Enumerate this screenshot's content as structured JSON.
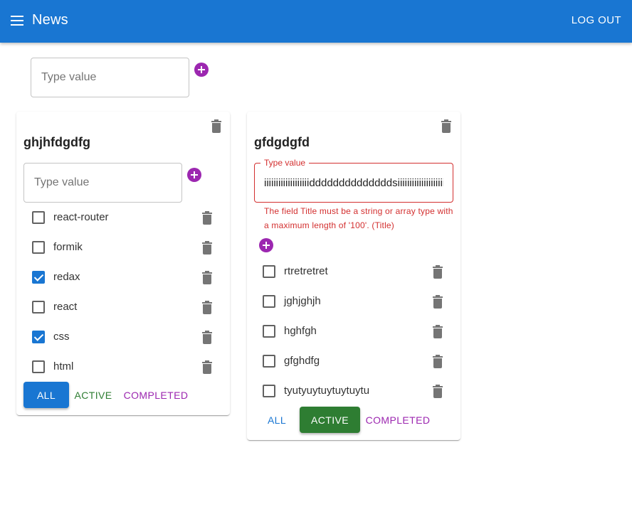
{
  "appbar": {
    "title": "News",
    "logout_label": "LOG OUT"
  },
  "new_list_input": {
    "placeholder": "Type value"
  },
  "lists": [
    {
      "title": "ghjhfdgdfg",
      "input": {
        "placeholder": "Type value"
      },
      "tasks": [
        {
          "label": "react-router",
          "checked": false
        },
        {
          "label": "formik",
          "checked": false
        },
        {
          "label": "redax",
          "checked": true
        },
        {
          "label": "react",
          "checked": false
        },
        {
          "label": "css",
          "checked": true
        },
        {
          "label": "html",
          "checked": false
        }
      ],
      "filters": {
        "all": "ALL",
        "active": "ACTIVE",
        "completed": "COMPLETED",
        "selected": "ALL"
      }
    },
    {
      "title": "gfdgdgfd",
      "input": {
        "label": "Type value",
        "value": "iiiiiiiiiiiiiiiiiiiddddddddddddddsiiiiiiiiiiiiiiiiiiiii",
        "error": "The field Title must be a string or array type with a maximum length of '100'. (Title)"
      },
      "tasks": [
        {
          "label": "rtretretret",
          "checked": false
        },
        {
          "label": "jghjghjh",
          "checked": false
        },
        {
          "label": "hghfgh",
          "checked": false
        },
        {
          "label": "gfghdfg",
          "checked": false
        },
        {
          "label": "tyutyuytuytuytuytu",
          "checked": false
        }
      ],
      "filters": {
        "all": "ALL",
        "active": "ACTIVE",
        "completed": "COMPLETED",
        "selected": "ACTIVE"
      }
    }
  ],
  "colors": {
    "primary": "#1976d2",
    "success": "#2e7d32",
    "secondary": "#9c27b0",
    "error": "#d32f2f"
  }
}
